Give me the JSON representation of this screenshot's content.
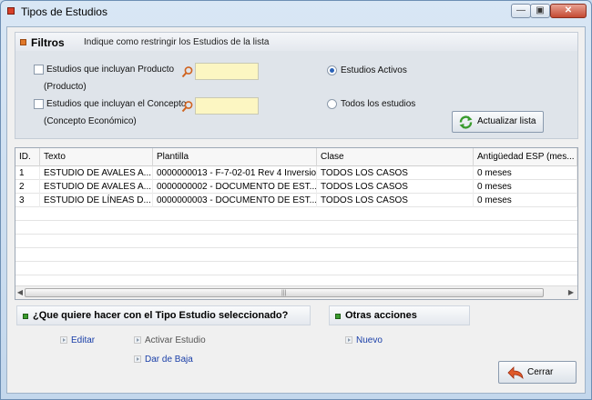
{
  "window": {
    "title": "Tipos de Estudios"
  },
  "filters": {
    "title": "Filtros",
    "hint": "Indique como restringir los Estudios de la lista",
    "producto": {
      "label": "Estudios que incluyan Producto",
      "sublabel": "(Producto)",
      "value": ""
    },
    "concepto": {
      "label": "Estudios que incluyan el Concepto",
      "sublabel": "(Concepto Económico)",
      "value": ""
    },
    "radio_activos": "Estudios Activos",
    "radio_todos": "Todos los estudios",
    "update_button": "Actualizar lista"
  },
  "table": {
    "columns": [
      "ID.",
      "Texto",
      "Plantilla",
      "Clase",
      "Antigüedad ESP (mes..."
    ],
    "rows": [
      {
        "id": "1",
        "texto": "ESTUDIO DE AVALES A...",
        "plantilla": "0000000013 - F-7-02-01 Rev 4 Inversio...",
        "clase": "TODOS LOS CASOS",
        "antiguedad": "0 meses"
      },
      {
        "id": "2",
        "texto": "ESTUDIO DE AVALES A...",
        "plantilla": "0000000002 - DOCUMENTO DE EST...",
        "clase": "TODOS LOS CASOS",
        "antiguedad": "0 meses"
      },
      {
        "id": "3",
        "texto": "ESTUDIO DE LÍNEAS D...",
        "plantilla": "0000000003 - DOCUMENTO DE EST...",
        "clase": "TODOS LOS CASOS",
        "antiguedad": "0 meses"
      }
    ]
  },
  "actions": {
    "question": "¿Que quiere hacer con el Tipo Estudio seleccionado?",
    "editar": "Editar",
    "activar": "Activar Estudio",
    "baja": "Dar de Baja",
    "otras_title": "Otras acciones",
    "nuevo": "Nuevo"
  },
  "close_button": "Cerrar",
  "colors": {
    "accent_orange": "#e0782a",
    "accent_green": "#3a9b2e",
    "link_blue": "#1a3fa8",
    "input_yellow": "#fcf6c2"
  }
}
